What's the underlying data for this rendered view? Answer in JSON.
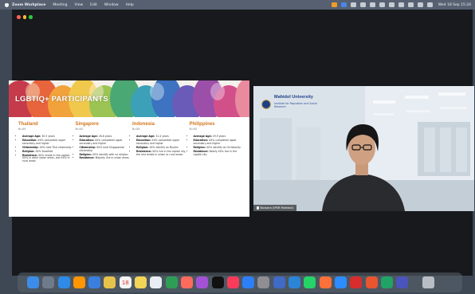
{
  "menubar": {
    "app_name": "Zoom Workplace",
    "items": [
      "Meeting",
      "View",
      "Edit",
      "Window",
      "Help"
    ],
    "clock": "Wed 18 Sep 15:24"
  },
  "slide": {
    "title": "LGBTIQ+ PARTICIPANTS",
    "columns": [
      {
        "country": "Thailand",
        "n": "N=XX",
        "bullets": [
          {
            "label": "Average Age:",
            "text": "30.5 years"
          },
          {
            "label": "Education:",
            "text": "XX% completed upper secondary and higher"
          },
          {
            "label": "Citizenship:",
            "text": "XX% hold Thai citizenship"
          },
          {
            "label": "Religion:",
            "text": "XX% Buddhist"
          },
          {
            "label": "Residence:",
            "text": "XX% reside in the capital, XX% in other urban areas, and XX% in rural areas"
          }
        ]
      },
      {
        "country": "Singapore",
        "n": "N=XX",
        "bullets": [
          {
            "label": "Average Age:",
            "text": "28.8 years"
          },
          {
            "label": "Education:",
            "text": "XX% completed upper secondary and higher"
          },
          {
            "label": "Citizenship:",
            "text": "XX% hold Singaporean citizenship"
          },
          {
            "label": "Religion:",
            "text": "XX% identify with no religion"
          },
          {
            "label": "Residence:",
            "text": "Majority live in urban areas"
          }
        ]
      },
      {
        "country": "Indonesia",
        "n": "N=XX",
        "bullets": [
          {
            "label": "Average Age:",
            "text": "31.4 years"
          },
          {
            "label": "Education:",
            "text": "XX% completed upper secondary and higher"
          },
          {
            "label": "Religion:",
            "text": "XX% identify as Muslim"
          },
          {
            "label": "Residence:",
            "text": "XX% live in the capital city, the rest reside in urban or rural areas"
          }
        ]
      },
      {
        "country": "Philippines",
        "n": "N=XX",
        "bullets": [
          {
            "label": "Average Age:",
            "text": "29.9 years"
          },
          {
            "label": "Education:",
            "text": "XX% completed upper secondary and higher"
          },
          {
            "label": "Religion:",
            "text": "XX% identify as Christianity"
          },
          {
            "label": "Residence:",
            "text": "Nearly XX% live in the capital city"
          }
        ]
      }
    ]
  },
  "speaker": {
    "org_name": "Mahidol University",
    "org_sub": "Institute for Population and Social Research",
    "participant": "Bussara (IPSR Mahidol)"
  },
  "dock": {
    "icons": [
      {
        "name": "finder-icon",
        "color": "#3d8de8"
      },
      {
        "name": "launchpad-icon",
        "color": "#6f7a8a"
      },
      {
        "name": "safari-icon",
        "color": "#2e8ae6"
      },
      {
        "name": "messages-icon",
        "color": "#ff9500"
      },
      {
        "name": "mail-icon",
        "color": "#3a7fe0"
      },
      {
        "name": "photos-icon",
        "color": "#e7c34b"
      },
      {
        "name": "calendar-icon",
        "color": "#f3f3f3",
        "label": "18"
      },
      {
        "name": "notes-icon",
        "color": "#f2d457"
      },
      {
        "name": "reminders-icon",
        "color": "#e9eef4"
      },
      {
        "name": "chrome-icon",
        "color": "#2f9e55"
      },
      {
        "name": "photo-booth-icon",
        "color": "#ff6a5c"
      },
      {
        "name": "podcasts-icon",
        "color": "#a352d6"
      },
      {
        "name": "apple-tv-icon",
        "color": "#111111"
      },
      {
        "name": "music-icon",
        "color": "#fa3c5a"
      },
      {
        "name": "app-store-icon",
        "color": "#2d7ff9"
      },
      {
        "name": "settings-icon",
        "color": "#8e8e93"
      },
      {
        "name": "preview-icon",
        "color": "#3f6ac5"
      },
      {
        "name": "vscode-icon",
        "color": "#2b84d6"
      },
      {
        "name": "whatsapp-icon",
        "color": "#25d366"
      },
      {
        "name": "firefox-icon",
        "color": "#ff7139"
      },
      {
        "name": "zoom-icon",
        "color": "#2d8cff"
      },
      {
        "name": "acrobat-icon",
        "color": "#d92c2c"
      },
      {
        "name": "office-icon",
        "color": "#e8552f"
      },
      {
        "name": "excel-icon",
        "color": "#21a366"
      },
      {
        "name": "teams-icon",
        "color": "#4b53bc"
      },
      {
        "name": "trash-icon",
        "color": "#b9bec5"
      }
    ]
  }
}
